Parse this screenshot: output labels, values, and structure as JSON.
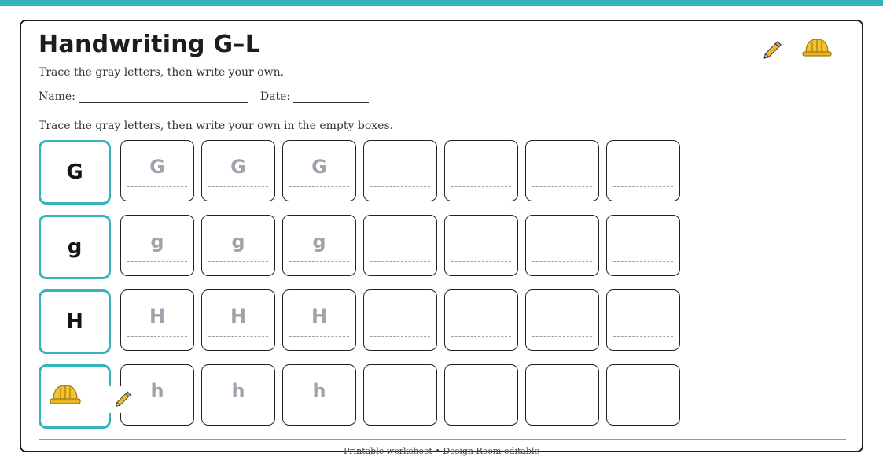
{
  "header": {
    "title": "Handwriting G–L",
    "subtitle": "Trace the gray letters, then write your own.",
    "name_label": "Name:",
    "date_label": "Date:"
  },
  "instructions": "Trace the gray letters, then write your own in the empty boxes.",
  "rows": [
    {
      "model": "G",
      "trace": [
        "G",
        "G",
        "G"
      ]
    },
    {
      "model": "g",
      "trace": [
        "g",
        "g",
        "g"
      ]
    },
    {
      "model": "H",
      "trace": [
        "H",
        "H",
        "H"
      ]
    },
    {
      "model": "",
      "trace": [
        "h",
        "h",
        "h"
      ]
    }
  ],
  "footer": "Printable worksheet • Design Room editable",
  "decorations": [
    "pencil-icon",
    "hard-hat-icon"
  ],
  "colors": {
    "accent": "#35b3bb",
    "trace": "#9ea3ad",
    "helmet": "#f2c230",
    "pencil": "#f0b92e"
  }
}
